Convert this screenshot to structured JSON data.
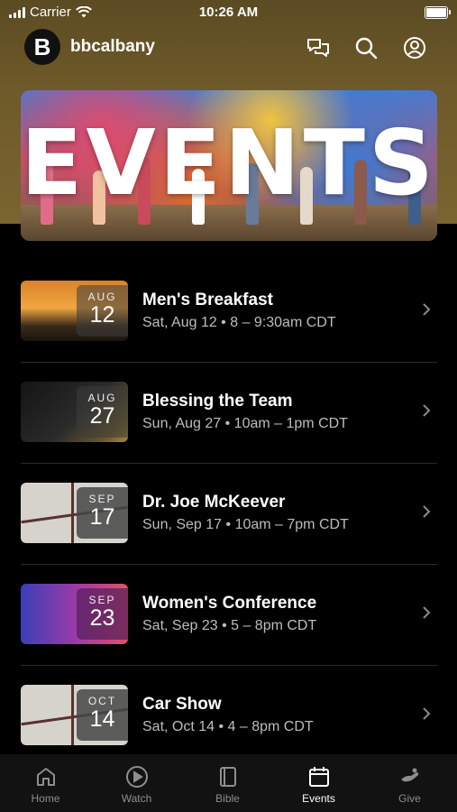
{
  "status": {
    "carrier": "Carrier",
    "time": "10:26 AM"
  },
  "app": {
    "name": "bbcalbany",
    "logo_letter": "B"
  },
  "banner": {
    "title": "EVENTS"
  },
  "events": [
    {
      "title": "Men's Breakfast",
      "when": "Sat, Aug 12 • 8 – 9:30am CDT",
      "month": "AUG",
      "day": "12"
    },
    {
      "title": "Blessing the Team",
      "when": "Sun, Aug 27 • 10am – 1pm CDT",
      "month": "AUG",
      "day": "27"
    },
    {
      "title": "Dr. Joe McKeever",
      "when": "Sun, Sep 17 • 10am – 7pm CDT",
      "month": "SEP",
      "day": "17"
    },
    {
      "title": "Women's Conference",
      "when": "Sat, Sep 23 • 5 – 8pm CDT",
      "month": "SEP",
      "day": "23"
    },
    {
      "title": "Car Show",
      "when": "Sat, Oct 14 • 4 – 8pm CDT",
      "month": "OCT",
      "day": "14"
    }
  ],
  "tabs": [
    {
      "label": "Home",
      "icon": "home-icon"
    },
    {
      "label": "Watch",
      "icon": "play-icon"
    },
    {
      "label": "Bible",
      "icon": "book-icon"
    },
    {
      "label": "Events",
      "icon": "calendar-icon",
      "active": true
    },
    {
      "label": "Give",
      "icon": "give-icon"
    }
  ]
}
